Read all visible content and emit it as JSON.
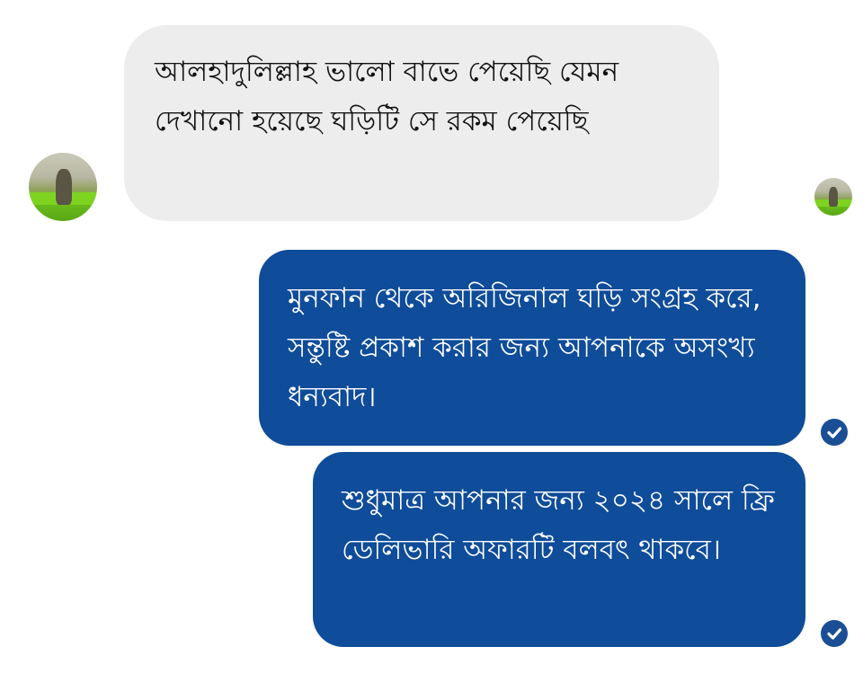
{
  "messages": [
    {
      "direction": "incoming",
      "text": "আলহাদুলিল্লাহ ভালো বাভে পেয়েছি যেমন দেখানো হয়েছে ঘড়িটি সে রকম পেয়েছি"
    },
    {
      "direction": "outgoing",
      "text": "মুনফান থেকে অরিজিনাল ঘড়ি সংগ্রহ করে, সন্তুষ্টি প্রকাশ করার জন্য আপনাকে অসংখ্য ধন্যবাদ।",
      "status": "sent"
    },
    {
      "direction": "outgoing",
      "text": "শুধুমাত্র আপনার জন্য ২০২৪ সালে ফ্রি ডেলিভারি অফারটি বলবৎ থাকবে।",
      "status": "sent"
    }
  ],
  "colors": {
    "incoming_bubble": "#ededed",
    "outgoing_bubble": "#0f4c9a",
    "seen_icon": "#1a4f96",
    "background": "#ffffff"
  },
  "icons": {
    "avatar": "avatar",
    "sent_status": "check-circle-icon"
  }
}
